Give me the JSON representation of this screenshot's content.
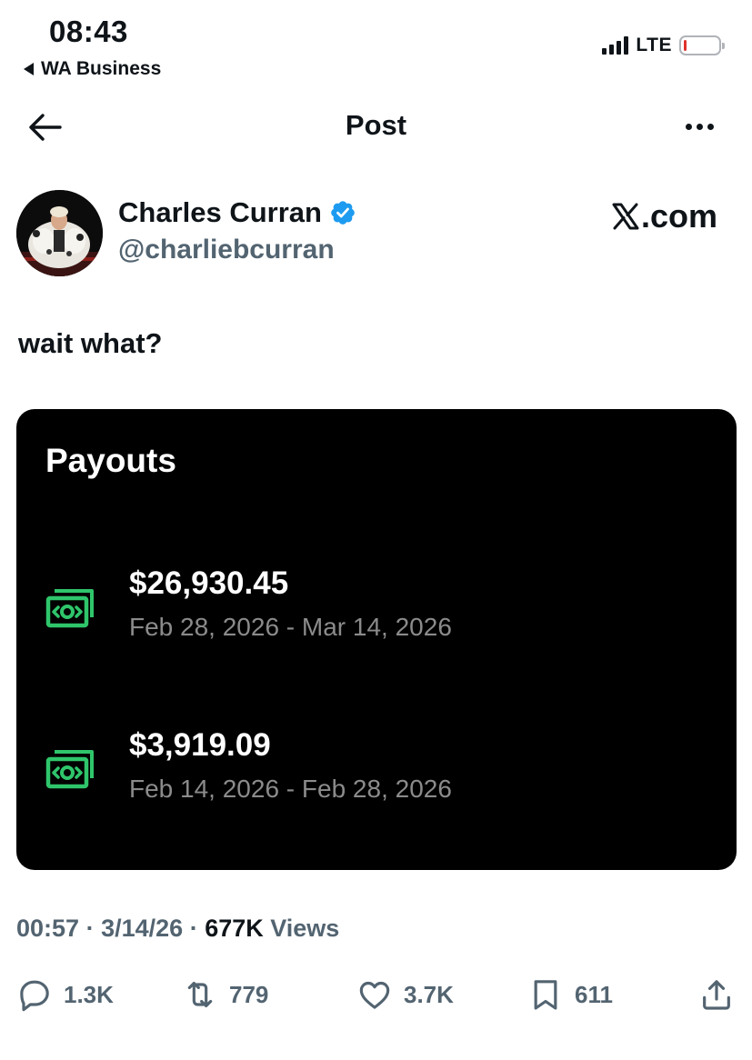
{
  "status_bar": {
    "time": "08:43",
    "back_app": "WA Business",
    "network": "LTE",
    "battery_level": 0.08
  },
  "header": {
    "title": "Post",
    "back_icon": "arrow-left-icon",
    "more_icon": "more-horizontal-icon"
  },
  "author": {
    "name": "Charles Curran",
    "handle": "@charliebcurran",
    "verified": true,
    "source": ".com"
  },
  "post": {
    "text": "wait what?"
  },
  "payouts_card": {
    "title": "Payouts",
    "items": [
      {
        "amount": "$26,930.45",
        "range": "Feb 28, 2026 - Mar 14, 2026",
        "icon": "money-icon"
      },
      {
        "amount": "$3,919.09",
        "range": "Feb 14, 2026 - Feb 28, 2026",
        "icon": "money-icon"
      }
    ]
  },
  "meta": {
    "time": "00:57",
    "date": "3/14/26",
    "views_count": "677K",
    "views_label": "Views"
  },
  "actions": {
    "replies": "1.3K",
    "reposts": "779",
    "likes": "3.7K",
    "bookmarks": "611"
  },
  "colors": {
    "text": "#0f1419",
    "secondary": "#536471",
    "verified_blue": "#1d9bf0",
    "money_green": "#2fc56b",
    "card_bg": "#000000"
  }
}
